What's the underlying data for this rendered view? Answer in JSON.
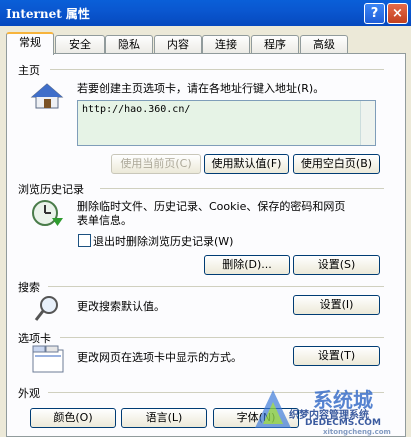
{
  "window": {
    "title": "Internet 属性",
    "help": "?",
    "close": "×"
  },
  "tabs": [
    "常规",
    "安全",
    "隐私",
    "内容",
    "连接",
    "程序",
    "高级"
  ],
  "home": {
    "title": "主页",
    "desc": "若要创建主页选项卡，请在各地址行键入地址(R)。",
    "url": "http://hao.360.cn/",
    "btn_current": "使用当前页(C)",
    "btn_default": "使用默认值(F)",
    "btn_blank": "使用空白页(B)"
  },
  "history": {
    "title": "浏览历史记录",
    "desc1": "删除临时文件、历史记录、Cookie、保存的密码和网页",
    "desc2": "表单信息。",
    "checkbox": "退出时删除浏览历史记录(W)",
    "btn_delete": "删除(D)...",
    "btn_settings": "设置(S)"
  },
  "search": {
    "title": "搜索",
    "desc": "更改搜索默认值。",
    "btn_settings": "设置(I)"
  },
  "tabsgroup": {
    "title": "选项卡",
    "desc": "更改网页在选项卡中显示的方式。",
    "btn_settings": "设置(T)"
  },
  "appearance": {
    "title": "外观",
    "btn_colors": "颜色(O)",
    "btn_languages": "语言(L)",
    "btn_fonts": "字体(N)"
  },
  "watermark": {
    "brand": "系统城",
    "site1": "织梦内容管理系统",
    "site2": "DEDECMS.COM",
    "site3": "xitongcheng.com"
  }
}
